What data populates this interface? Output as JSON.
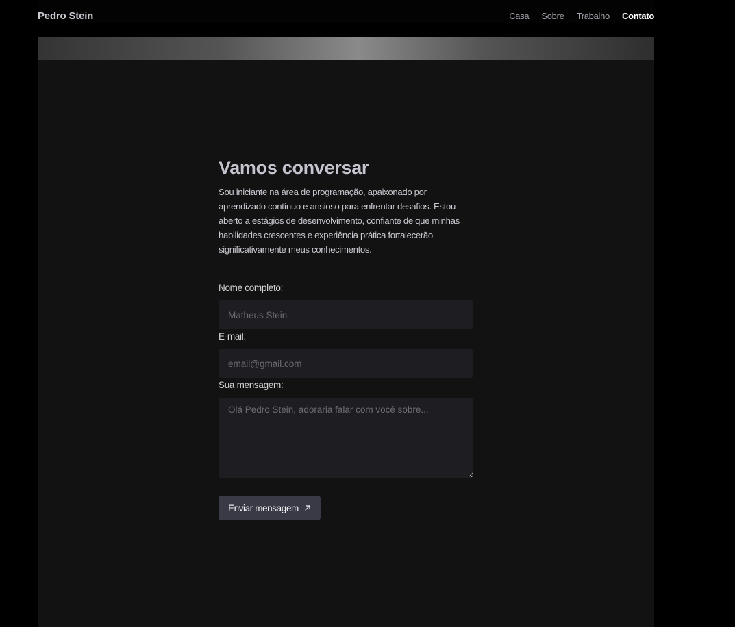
{
  "header": {
    "brand": "Pedro Stein",
    "nav": [
      {
        "label": "Casa",
        "active": false
      },
      {
        "label": "Sobre",
        "active": false
      },
      {
        "label": "Trabalho",
        "active": false
      },
      {
        "label": "Contato",
        "active": true
      }
    ]
  },
  "contact": {
    "title": "Vamos conversar",
    "intro": "Sou iniciante na área de programação, apaixonado por aprendizado contínuo e ansioso para enfrentar desafios. Estou aberto a estágios de desenvolvimento, confiante de que minhas habilidades crescentes e experiência prática fortalecerão significativamente meus conhecimentos.",
    "form": {
      "name_label": "Nome completo:",
      "name_placeholder": "Matheus Stein",
      "name_value": "",
      "email_label": "E-mail:",
      "email_placeholder": "email@gmail.com",
      "email_value": "",
      "message_label": "Sua mensagem:",
      "message_placeholder": "Olá Pedro Stein, adoraria falar com você sobre...",
      "message_value": "",
      "submit_label": "Enviar mensagem",
      "submit_icon": "arrow-up-right-icon"
    }
  },
  "colors": {
    "page_bg": "#000000",
    "panel_bg": "#121212",
    "input_bg": "#1e1e22",
    "button_bg": "#3a3a46",
    "title": "#c4c4cf",
    "active_nav": "#ffffff"
  }
}
